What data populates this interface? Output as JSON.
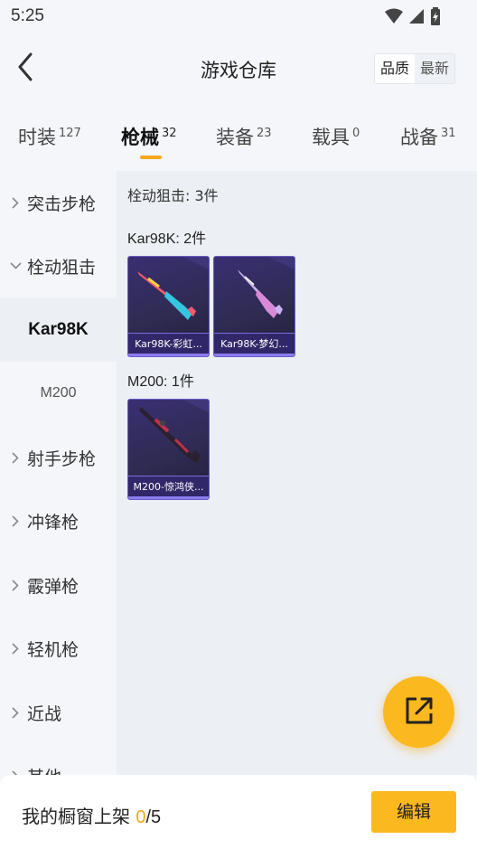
{
  "status": {
    "time": "5:25"
  },
  "header": {
    "title": "游戏仓库",
    "sort_quality": "品质",
    "sort_latest": "最新"
  },
  "tabs": [
    {
      "label": "时装",
      "count": "127"
    },
    {
      "label": "枪械",
      "count": "32"
    },
    {
      "label": "装备",
      "count": "23"
    },
    {
      "label": "载具",
      "count": "0"
    },
    {
      "label": "战备",
      "count": "31"
    }
  ],
  "active_tab": "枪械",
  "sidebar": {
    "items": [
      {
        "label": "突击步枪"
      },
      {
        "label": "栓动狙击"
      },
      {
        "label": "Kar98K"
      },
      {
        "label": "M200"
      },
      {
        "label": "射手步枪"
      },
      {
        "label": "冲锋枪"
      },
      {
        "label": "霰弹枪"
      },
      {
        "label": "轻机枪"
      },
      {
        "label": "近战"
      },
      {
        "label": "其他"
      }
    ]
  },
  "content": {
    "section_title": "栓动狙击: 3件",
    "groups": [
      {
        "title": "Kar98K: 2件",
        "items": [
          {
            "name": "Kar98K-彩虹..."
          },
          {
            "name": "Kar98K-梦幻..."
          }
        ]
      },
      {
        "title": "M200: 1件",
        "items": [
          {
            "name": "M200-惊鸿侠..."
          }
        ]
      }
    ]
  },
  "bottom": {
    "shelf_label": "我的橱窗上架 ",
    "shelf_current": "0",
    "shelf_sep": "/",
    "shelf_max": "5",
    "edit_label": "编辑"
  },
  "colors": {
    "accent": "#f5a81a",
    "card_bg": "#2f2b52",
    "card_border": "#6a5cc8",
    "content_bg": "#eceff3"
  }
}
